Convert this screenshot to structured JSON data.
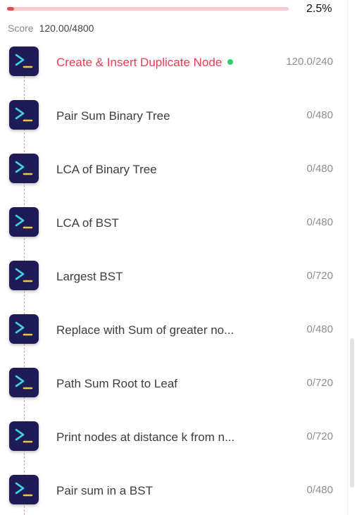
{
  "progress": {
    "fraction": 0.025,
    "percent_text": "2.5%",
    "fill_color": "#ee4b55",
    "track_color": "#f9c9cc"
  },
  "score": {
    "label": "Score",
    "value": "120.00/4800"
  },
  "items": [
    {
      "title": "Create & Insert Duplicate Node",
      "score": "120.0/240",
      "active": true,
      "icon": "terminal-icon"
    },
    {
      "title": "Pair Sum Binary Tree",
      "score": "0/480",
      "active": false,
      "icon": "terminal-icon"
    },
    {
      "title": "LCA of Binary Tree",
      "score": "0/480",
      "active": false,
      "icon": "terminal-icon"
    },
    {
      "title": "LCA of BST",
      "score": "0/480",
      "active": false,
      "icon": "terminal-icon"
    },
    {
      "title": "Largest BST",
      "score": "0/720",
      "active": false,
      "icon": "terminal-icon"
    },
    {
      "title": "Replace with Sum of greater no...",
      "score": "0/480",
      "active": false,
      "icon": "terminal-icon"
    },
    {
      "title": "Path Sum Root to Leaf",
      "score": "0/720",
      "active": false,
      "icon": "terminal-icon"
    },
    {
      "title": "Print nodes at distance k from n...",
      "score": "0/720",
      "active": false,
      "icon": "terminal-icon"
    },
    {
      "title": "Pair sum in a BST",
      "score": "0/480",
      "active": false,
      "icon": "terminal-icon"
    }
  ],
  "colors": {
    "icon_bg": "#1f1b56",
    "icon_chevron": "#3fd0e0",
    "icon_underscore": "#f3c83d",
    "active_title": "#ee3b52",
    "status_dot": "#2ecc71"
  }
}
